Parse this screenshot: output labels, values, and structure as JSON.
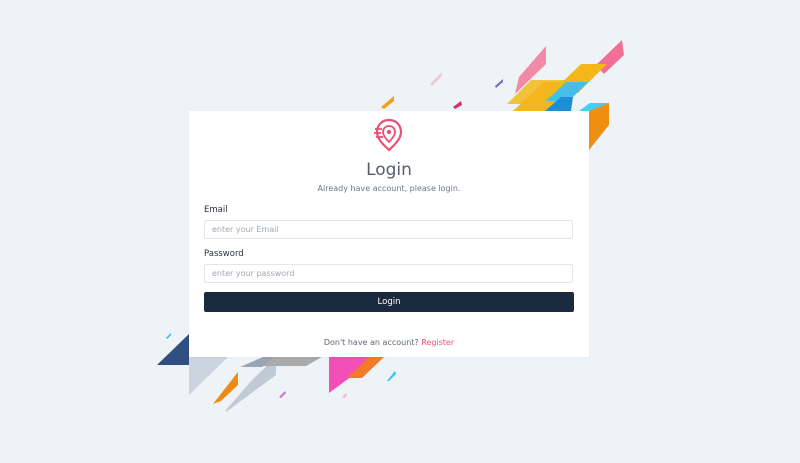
{
  "brand": {
    "logo_icon": "location-pin-icon",
    "accent_color": "#ef4f73",
    "button_color": "#1c2a3f"
  },
  "login": {
    "title": "Login",
    "subtitle": "Already have account, please login.",
    "email": {
      "label": "Email",
      "placeholder": "enter your Email",
      "value": ""
    },
    "password": {
      "label": "Password",
      "placeholder": "enter your password",
      "value": ""
    },
    "submit_label": "Login",
    "footer": {
      "prompt": "Don't have an account?",
      "link_label": "Register"
    }
  }
}
